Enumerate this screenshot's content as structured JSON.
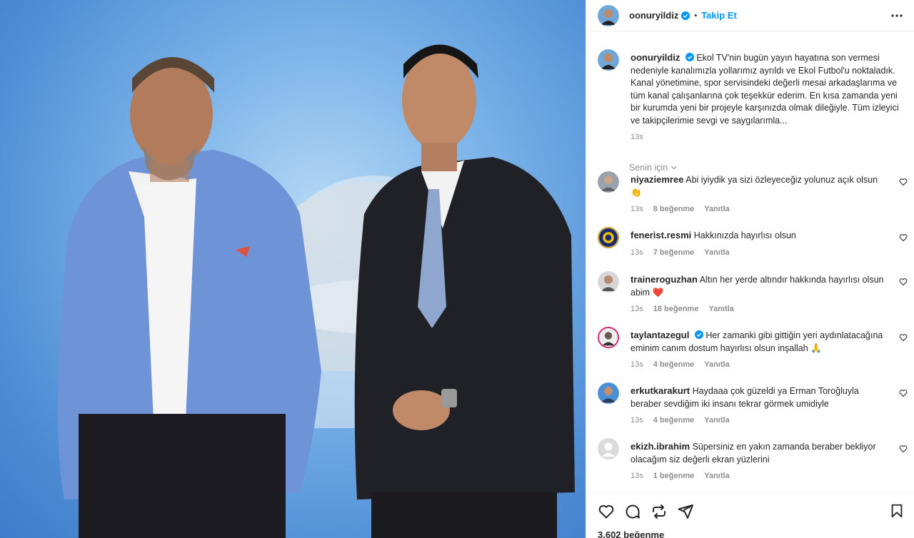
{
  "post": {
    "username": "oonuryildiz",
    "follow_label": "Takip Et",
    "dot": "•",
    "caption": "Ekol TV'nin bugün yayın hayatına son vermesi nedeniyle kanalımızla yollarımız ayrıldı ve Ekol Futbol'u noktaladık. Kanal yönetimine, spor servisindeki değerli mesai arkadaşlarıma ve tüm kanal çalışanlarına çok teşekkür ederim. En kısa zamanda yeni bir kurumda yeni bir projeyle karşınızda olmak dileğiyle. Tüm izleyici ve takipçilerimie sevgi ve saygılarımla...",
    "time": "13s",
    "sort_label": "Senin için",
    "likes": "3.602 beğenme"
  },
  "comments": [
    {
      "user": "niyaziemree",
      "text": "Abi iyiydik ya sizi özleyeceğiz yolunuz açık olsun 👏",
      "time": "13s",
      "likes": "8 beğenme",
      "reply": "Yanıtla"
    },
    {
      "user": "fenerist.resmi",
      "text": "Hakkınızda hayırlısı olsun",
      "time": "13s",
      "likes": "7 beğenme",
      "reply": "Yanıtla"
    },
    {
      "user": "traineroguzhan",
      "text": "Altın her yerde altındır hakkında hayırlısı olsun abim ❤️",
      "time": "13s",
      "likes": "18 beğenme",
      "reply": "Yanıtla"
    },
    {
      "user": "taylantazegul",
      "text": "Her zamanki gibi gittiğin yeri aydınlatacağına eminim canım dostum hayırlısı olsun inşallah 🙏",
      "time": "13s",
      "likes": "4 beğenme",
      "reply": "Yanıtla"
    },
    {
      "user": "erkutkarakurt",
      "text": "Haydaaa çok güzeldi ya Erman Toroğluyla beraber sevdiğim iki insanı tekrar görmek umidiyle",
      "time": "13s",
      "likes": "4 beğenme",
      "reply": "Yanıtla"
    },
    {
      "user": "ekizh.ibrahim",
      "text": "Süpersiniz en yakın zamanda beraber bekliyor olacağım siz değerli ekran yüzlerini",
      "time": "13s",
      "likes": "1 beğenme",
      "reply": "Yanıtla"
    }
  ],
  "colors": {
    "accent": "#0095f6",
    "text": "#262626",
    "secondary": "#8e8e8e"
  },
  "icons": {
    "header": [
      "verified-badge-icon",
      "more-options-icon"
    ],
    "actions": [
      "heart-icon",
      "comment-icon",
      "share-icon",
      "send-icon",
      "bookmark-icon"
    ]
  }
}
